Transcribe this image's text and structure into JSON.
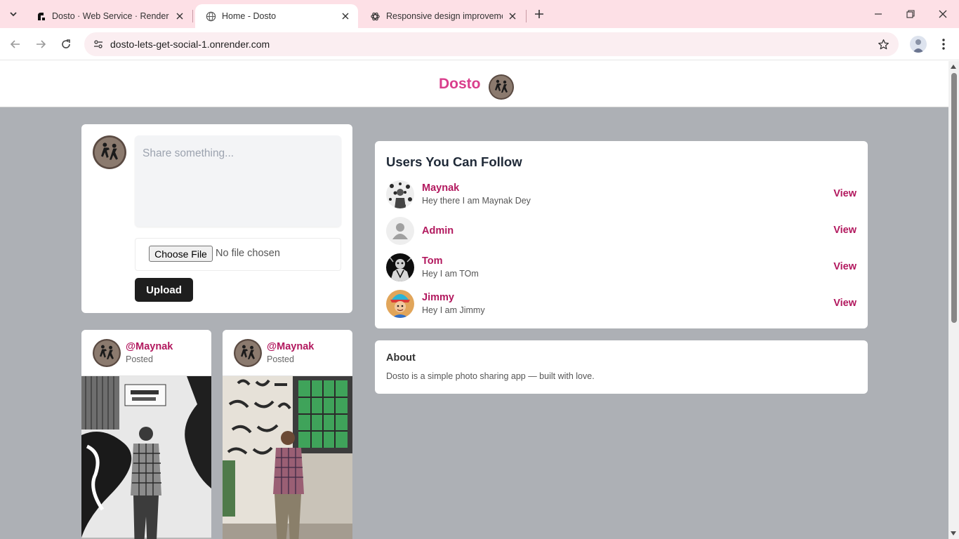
{
  "browser": {
    "tabs": [
      {
        "title": "Dosto · Web Service · Render D",
        "active": false,
        "icon": "render-icon"
      },
      {
        "title": "Home - Dosto",
        "active": true,
        "icon": "globe-icon"
      },
      {
        "title": "Responsive design improvemen",
        "active": false,
        "icon": "chatgpt-icon"
      }
    ],
    "url": "dosto-lets-get-social-1.onrender.com"
  },
  "header": {
    "brand": "Dosto"
  },
  "composer": {
    "placeholder": "Share something...",
    "file_button": "Choose File",
    "file_status": "No file chosen",
    "upload_label": "Upload"
  },
  "posts": [
    {
      "username": "@Maynak",
      "status": "Posted"
    },
    {
      "username": "@Maynak",
      "status": "Posted"
    }
  ],
  "follow": {
    "title": "Users You Can Follow",
    "users": [
      {
        "name": "Maynak",
        "bio": "Hey there I am Maynak Dey",
        "action": "View"
      },
      {
        "name": "Admin",
        "bio": "",
        "action": "View"
      },
      {
        "name": "Tom",
        "bio": "Hey I am TOm",
        "action": "View"
      },
      {
        "name": "Jimmy",
        "bio": "Hey I am Jimmy",
        "action": "View"
      }
    ]
  },
  "about": {
    "title": "About",
    "text": "Dosto is a simple photo sharing app — built with love."
  },
  "colors": {
    "brand": "#d93e8c",
    "link": "#b2185e",
    "page_background": "#adb0b5",
    "tabstrip": "#fde0e6",
    "upload_button": "#1e1e1e"
  }
}
